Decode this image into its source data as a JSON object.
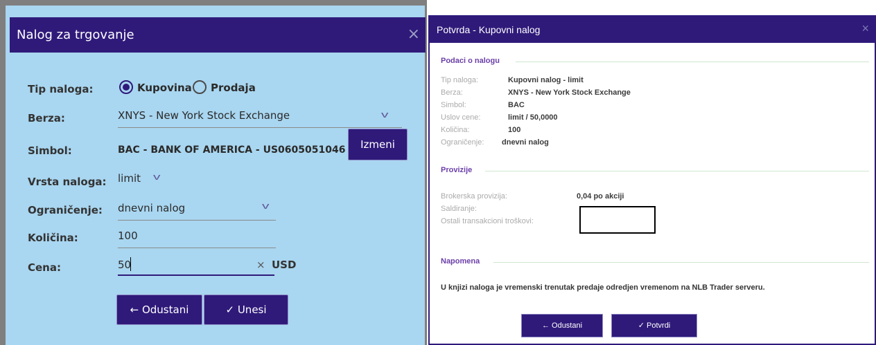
{
  "order_dialog": {
    "title": "Nalog za trgovanje",
    "close_icon": "×",
    "order_type": {
      "label": "Tip naloga:",
      "buy": "Kupovina",
      "sell": "Prodaja",
      "selected": "Kupovina"
    },
    "exchange": {
      "label": "Berza:",
      "value": "XNYS - New York Stock Exchange"
    },
    "symbol": {
      "label": "Simbol:",
      "value": "BAC - BANK OF AMERICA - US0605051046",
      "change_button": "Izmeni"
    },
    "order_kind": {
      "label": "Vrsta naloga:",
      "value": "limit"
    },
    "restriction": {
      "label": "Ograničenje:",
      "value": "dnevni nalog"
    },
    "quantity": {
      "label": "Količina:",
      "value": "100"
    },
    "price": {
      "label": "Cena:",
      "value": "50",
      "clear_icon": "×",
      "currency": "USD"
    },
    "cancel_button": "Odustani",
    "submit_button": "Unesi"
  },
  "confirm_dialog": {
    "title": "Potvrda - Kupovni nalog",
    "close_icon": "×",
    "order_section": {
      "title": "Podaci o nalogu",
      "rows": [
        {
          "label": "Tip naloga:",
          "value": "Kupovni nalog - limit"
        },
        {
          "label": "Berza:",
          "value": "XNYS - New York Stock Exchange"
        },
        {
          "label": "Simbol:",
          "value": "BAC"
        },
        {
          "label": "Uslov cene:",
          "value": "limit / 50,0000"
        },
        {
          "label": "Količina:",
          "value": "100"
        },
        {
          "label": "Ograničenje:",
          "value": "dnevni nalog"
        }
      ]
    },
    "commission_section": {
      "title": "Provizije",
      "rows": [
        {
          "label": "Brokerska provizija:",
          "value": "0,04 po akciji"
        },
        {
          "label": "Saldiranje:",
          "value": ""
        },
        {
          "label": "Ostali transakcioni troškovi:",
          "value": ""
        }
      ]
    },
    "note_section": {
      "title": "Napomena",
      "text": "U knjizi naloga je vremenski trenutak predaje odredjen vremenom na NLB Trader serveru."
    },
    "cancel_button": "Odustani",
    "confirm_button": "Potvrdi"
  },
  "colors": {
    "title_bar": "#2f1a7a",
    "dialog_background": "#a9d6f0",
    "section_heading": "#6b3ea8"
  },
  "icons": {
    "back": "arrow-left-icon",
    "check": "checkmark-icon",
    "dropdown": "chevron-down-icon"
  }
}
